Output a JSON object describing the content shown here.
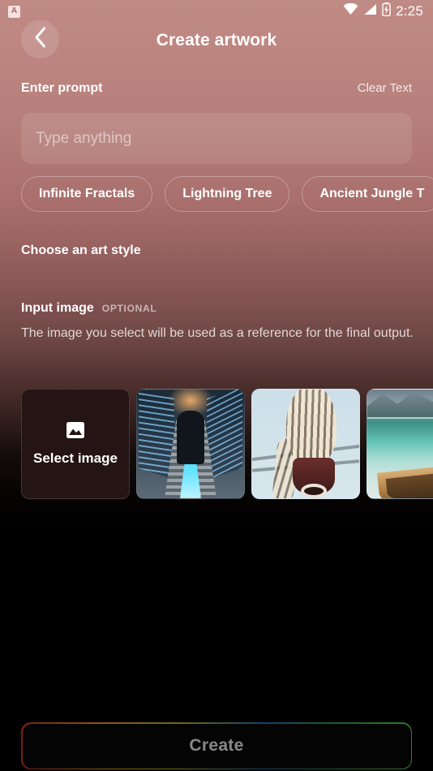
{
  "statusbar": {
    "notification_icon": "app-letter-a-icon",
    "notification_letter": "A",
    "wifi_icon": "wifi-icon",
    "signal_icon": "cellular-signal-icon",
    "battery_icon": "battery-charging-icon",
    "time": "2:25"
  },
  "appbar": {
    "back_icon": "chevron-left-icon",
    "title": "Create artwork"
  },
  "prompt": {
    "label": "Enter prompt",
    "clear_label": "Clear Text",
    "value": "",
    "placeholder": "Type anything",
    "suggestions": [
      {
        "label": "Infinite Fractals"
      },
      {
        "label": "Lightning Tree"
      },
      {
        "label": "Ancient Jungle T"
      }
    ]
  },
  "art_style": {
    "label": "Choose an art style"
  },
  "input_image": {
    "label": "Input image",
    "badge": "OPTIONAL",
    "description": "The image you select will be used as a reference for the final output.",
    "select_card": {
      "icon": "image-picture-icon",
      "label": "Select image"
    },
    "thumbnails": [
      {
        "name": "escalator-hooded-figure-photo"
      },
      {
        "name": "owl-on-power-line-photo"
      },
      {
        "name": "boat-on-alpine-lake-photo"
      }
    ]
  },
  "footer": {
    "create_label": "Create"
  },
  "colors": {
    "background_top": "#c08a85",
    "background_bottom": "#000000",
    "accent_border": "#7a1f14",
    "text_primary": "#ffffff",
    "create_text": "#888888"
  }
}
